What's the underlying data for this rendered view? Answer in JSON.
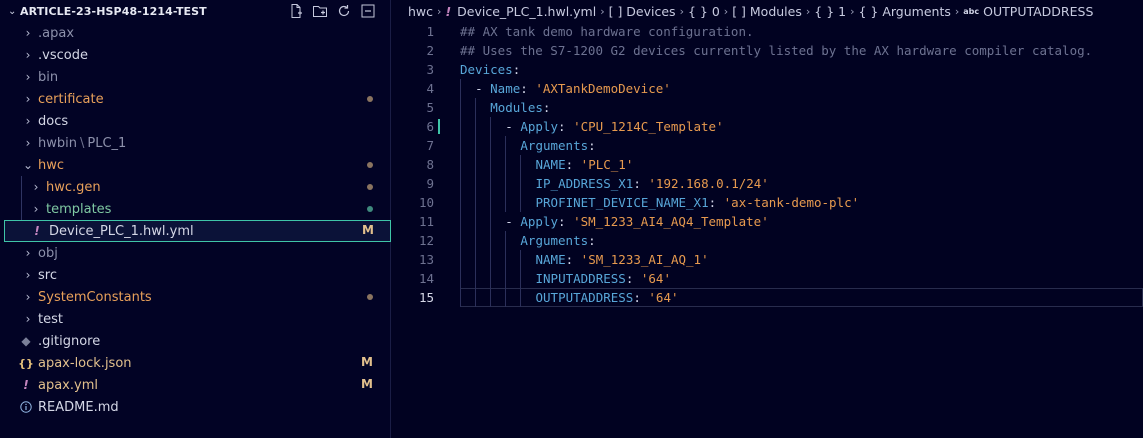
{
  "explorer": {
    "title": "ARTICLE-23-HSP48-1214-TEST",
    "actions": [
      "new-file-icon",
      "new-folder-icon",
      "refresh-icon",
      "collapse-all-icon"
    ],
    "items": [
      {
        "label": ".apax",
        "kind": "folder",
        "color": "gray",
        "status": ""
      },
      {
        "label": ".vscode",
        "kind": "folder",
        "color": "white",
        "status": ""
      },
      {
        "label": "bin",
        "kind": "folder",
        "color": "gray",
        "status": ""
      },
      {
        "label": "certificate",
        "kind": "folder",
        "color": "orange",
        "status": "dot"
      },
      {
        "label": "docs",
        "kind": "folder",
        "color": "white",
        "status": ""
      },
      {
        "label": "hwbin",
        "label_suffix": "PLC_1",
        "kind": "folder",
        "color": "gray",
        "status": ""
      },
      {
        "label": "hwc",
        "kind": "folder-open",
        "color": "orange",
        "status": "dot"
      },
      {
        "label": "hwc.gen",
        "kind": "folder",
        "color": "orange",
        "status": "dot",
        "nested": true
      },
      {
        "label": "templates",
        "kind": "folder",
        "color": "green",
        "status": "dot-green",
        "nested": true
      },
      {
        "label": "Device_PLC_1.hwl.yml",
        "kind": "yaml",
        "color": "mod",
        "status": "M",
        "nested": true,
        "selected": true
      },
      {
        "label": "obj",
        "kind": "folder",
        "color": "gray",
        "status": ""
      },
      {
        "label": "src",
        "kind": "folder",
        "color": "white",
        "status": ""
      },
      {
        "label": "SystemConstants",
        "kind": "folder",
        "color": "orange",
        "status": "dot"
      },
      {
        "label": "test",
        "kind": "folder",
        "color": "white",
        "status": ""
      },
      {
        "label": ".gitignore",
        "kind": "git",
        "color": "white",
        "status": ""
      },
      {
        "label": "apax-lock.json",
        "kind": "json",
        "color": "mod",
        "status": "M"
      },
      {
        "label": "apax.yml",
        "kind": "yaml",
        "color": "mod",
        "status": "M"
      },
      {
        "label": "README.md",
        "kind": "info",
        "color": "white",
        "status": ""
      }
    ]
  },
  "breadcrumb": [
    "hwc",
    "Device_PLC_1.hwl.yml",
    "[ ] Devices",
    "{ } 0",
    "[ ] Modules",
    "{ } 1",
    "{ } Arguments",
    "OUTPUTADDRESS"
  ],
  "breadcrumb_abc": "abc",
  "editor": {
    "active_line": 15,
    "lines": [
      {
        "n": "1",
        "indent": 0,
        "tokens": [
          [
            "comment",
            "## AX tank demo hardware configuration."
          ]
        ]
      },
      {
        "n": "2",
        "indent": 0,
        "tokens": [
          [
            "comment",
            "## Uses the S7-1200 G2 devices currently listed by the AX hardware compiler catalog."
          ]
        ]
      },
      {
        "n": "3",
        "indent": 0,
        "tokens": [
          [
            "key",
            "Devices"
          ],
          [
            "punc",
            ":"
          ]
        ]
      },
      {
        "n": "4",
        "indent": 1,
        "tokens": [
          [
            "dash",
            "- "
          ],
          [
            "key",
            "Name"
          ],
          [
            "punc",
            ": "
          ],
          [
            "str",
            "'AXTankDemoDevice'"
          ]
        ]
      },
      {
        "n": "5",
        "indent": 2,
        "tokens": [
          [
            "key",
            "Modules"
          ],
          [
            "punc",
            ":"
          ]
        ]
      },
      {
        "n": "6",
        "indent": 3,
        "tokens": [
          [
            "dash",
            "- "
          ],
          [
            "key",
            "Apply"
          ],
          [
            "punc",
            ": "
          ],
          [
            "str",
            "'CPU_1214C_Template'"
          ]
        ]
      },
      {
        "n": "7",
        "indent": 4,
        "tokens": [
          [
            "key",
            "Arguments"
          ],
          [
            "punc",
            ":"
          ]
        ]
      },
      {
        "n": "8",
        "indent": 5,
        "tokens": [
          [
            "key",
            "NAME"
          ],
          [
            "punc",
            ": "
          ],
          [
            "str",
            "'PLC_1'"
          ]
        ]
      },
      {
        "n": "9",
        "indent": 5,
        "tokens": [
          [
            "key",
            "IP_ADDRESS_X1"
          ],
          [
            "punc",
            ": "
          ],
          [
            "str",
            "'192.168.0.1/24'"
          ]
        ]
      },
      {
        "n": "10",
        "indent": 5,
        "tokens": [
          [
            "key",
            "PROFINET_DEVICE_NAME_X1"
          ],
          [
            "punc",
            ": "
          ],
          [
            "str",
            "'ax-tank-demo-plc'"
          ]
        ]
      },
      {
        "n": "11",
        "indent": 3,
        "tokens": [
          [
            "dash",
            "- "
          ],
          [
            "key",
            "Apply"
          ],
          [
            "punc",
            ": "
          ],
          [
            "str",
            "'SM_1233_AI4_AQ4_Template'"
          ]
        ]
      },
      {
        "n": "12",
        "indent": 4,
        "tokens": [
          [
            "key",
            "Arguments"
          ],
          [
            "punc",
            ":"
          ]
        ]
      },
      {
        "n": "13",
        "indent": 5,
        "tokens": [
          [
            "key",
            "NAME"
          ],
          [
            "punc",
            ": "
          ],
          [
            "str",
            "'SM_1233_AI_AQ_1'"
          ]
        ]
      },
      {
        "n": "14",
        "indent": 5,
        "tokens": [
          [
            "key",
            "INPUTADDRESS"
          ],
          [
            "punc",
            ": "
          ],
          [
            "str",
            "'64'"
          ]
        ]
      },
      {
        "n": "15",
        "indent": 5,
        "tokens": [
          [
            "key",
            "OUTPUTADDRESS"
          ],
          [
            "punc",
            ": "
          ],
          [
            "str",
            "'64'"
          ]
        ]
      }
    ]
  },
  "colors": {
    "background": "#010221",
    "selection_outline": "#3fc5a8",
    "modified": "#e2c08d",
    "string": "#e79a4f",
    "key": "#58a6d8",
    "comment": "#6d7291"
  }
}
